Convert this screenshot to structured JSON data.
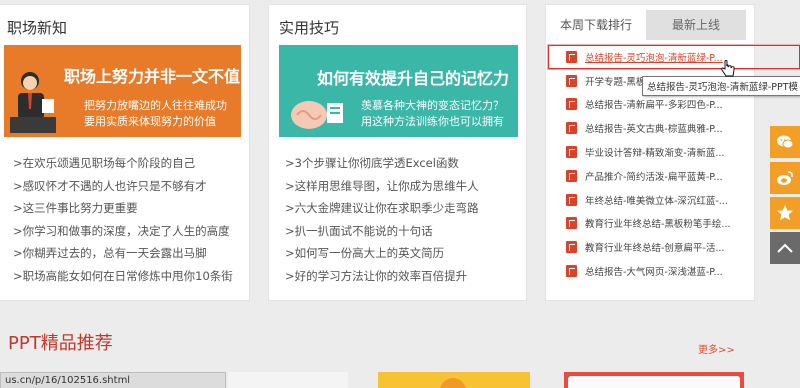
{
  "workplace": {
    "title": "职场新知",
    "banner": {
      "headline": "职场上努力并非一文不值",
      "line1": "把努力放嘴边的人往往难成功",
      "line2": "要用实质来体现努力的价值"
    },
    "items": [
      ">在欢乐颂遇见职场每个阶段的自己",
      ">感叹怀才不遇的人也许只是不够有才",
      ">这三件事比努力更重要",
      ">你学习和做事的深度，决定了人生的高度",
      ">你糊弄过去的，总有一天会露出马脚",
      ">职场高能女如何在日常修炼中甩你10条街"
    ]
  },
  "tips": {
    "title": "实用技巧",
    "banner": {
      "headline": "如何有效提升自己的记忆力",
      "line1": "羡慕各种大神的变态记忆力？",
      "line2": "用这种方法训练你也可以拥有"
    },
    "items": [
      ">3个步骤让你彻底学透Excel函数",
      ">这样用思维导图，让你成为思维牛人",
      ">六大金牌建议让你在求职季少走弯路",
      ">扒一扒面试不能说的十句话",
      ">如何写一份高大上的英文简历",
      ">好的学习方法让你的效率百倍提升"
    ]
  },
  "ranking": {
    "tab_week": "本周下载排行",
    "tab_new": "最新上线",
    "items": [
      "总结报告-灵巧泡泡-清新蓝绿-P...",
      "开学专题-黑板",
      "总结报告-清新扁平-多彩四色-P...",
      "总结报告-英文古典-棕蓝典雅-P...",
      "毕业设计答辩-精致渐变-清新蓝...",
      "产品推介-简约活泼-扁平蓝黄-P...",
      "年终总结-唯美微立体-深沉红蓝-...",
      "教育行业年终总结-黑板粉笔手绘...",
      "教育行业年终总结-创意扁平-活...",
      "总结报告-大气网页-深浅湛蓝-P..."
    ],
    "tooltip": "总结报告-灵巧泡泡-清新蓝绿-PPT模"
  },
  "sidebar": {
    "icons": [
      "chat-icon",
      "weibo-icon",
      "star-icon",
      "chevron-up-icon"
    ]
  },
  "section": {
    "title": "PPT精品推荐",
    "more": "更多>>"
  },
  "status_url": "us.cn/p/16/102516.shtml",
  "colors": {
    "accent_orange": "#f29f28",
    "teal": "#3bb7a8",
    "brand_red": "#c0392b"
  }
}
